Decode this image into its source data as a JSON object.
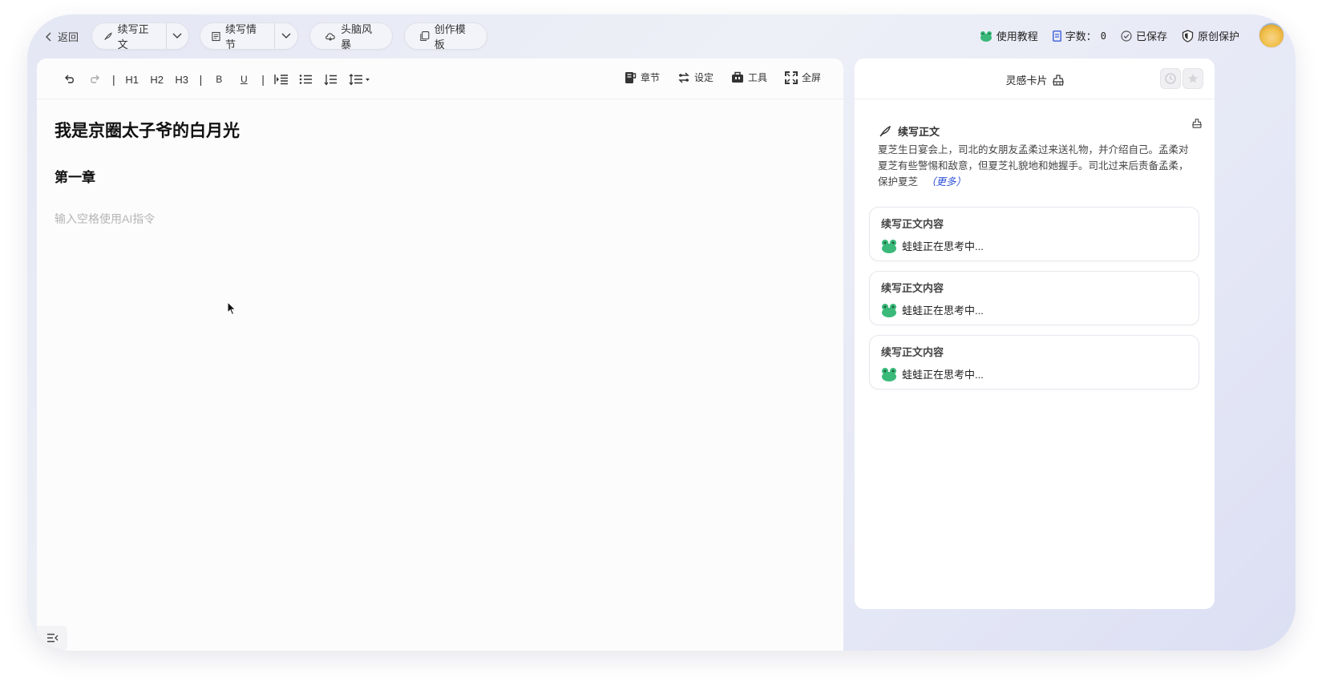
{
  "header": {
    "back_label": "返回",
    "continue_text_label": "续写正文",
    "continue_plot_label": "续写情节",
    "brainstorm_label": "头脑风暴",
    "template_label": "创作模板",
    "tutorial_label": "使用教程",
    "word_count_label": "字数：",
    "word_count_value": "0",
    "saved_label": "已保存",
    "protect_label": "原创保护"
  },
  "toolbar": {
    "h1": "H1",
    "h2": "H2",
    "h3": "H3",
    "bold": "B",
    "underline": "U",
    "sep": "|",
    "chapter_label": "章节",
    "settings_label": "设定",
    "tools_label": "工具",
    "fullscreen_label": "全屏"
  },
  "document": {
    "title": "我是京圈太子爷的白月光",
    "chapter": "第一章",
    "placeholder": "输入空格使用AI指令"
  },
  "panel": {
    "title": "灵感卡片",
    "summary_heading": "续写正文",
    "summary_text": "夏芝生日宴会上，司北的女朋友孟柔过来送礼物，并介绍自己。孟柔对夏芝有些警惕和敌意，但夏芝礼貌地和她握手。司北过来后责备孟柔，保护夏芝",
    "more_label": "（更多）",
    "cards": [
      {
        "title": "续写正文内容",
        "status": "蛙蛙正在思考中..."
      },
      {
        "title": "续写正文内容",
        "status": "蛙蛙正在思考中..."
      },
      {
        "title": "续写正文内容",
        "status": "蛙蛙正在思考中..."
      }
    ]
  },
  "colors": {
    "accent_link": "#2a4fd6",
    "frog_green": "#3ab97a",
    "word_count_icon": "#3b5bd9"
  }
}
